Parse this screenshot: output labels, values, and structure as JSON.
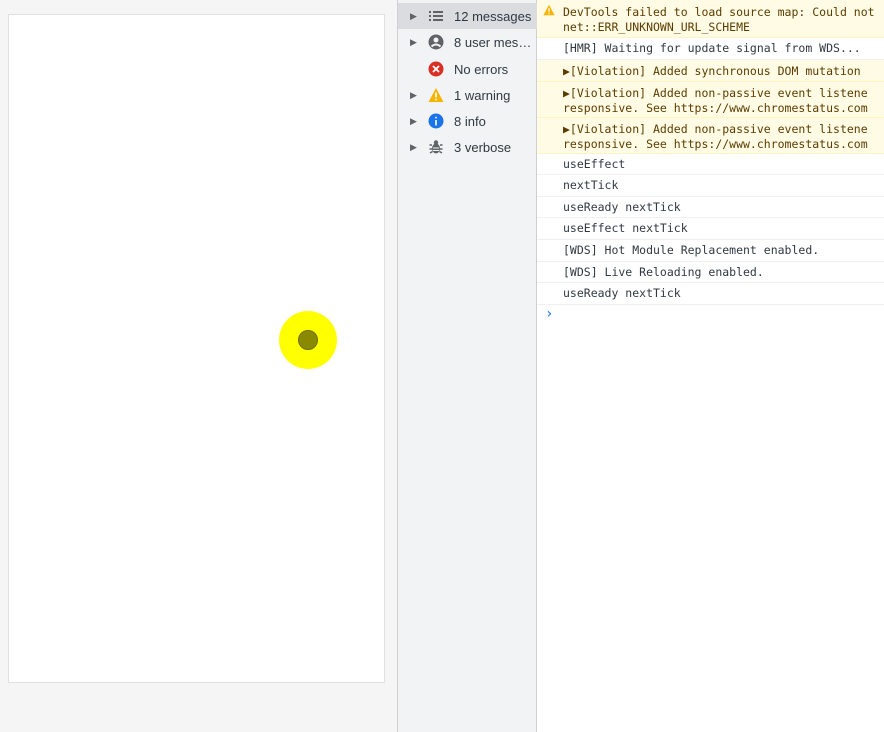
{
  "sidebar": {
    "items": [
      {
        "label": "12 messages",
        "icon": "list-icon",
        "arrow": true,
        "selected": true
      },
      {
        "label": "8 user mess…",
        "icon": "user-icon",
        "arrow": true,
        "selected": false
      },
      {
        "label": "No errors",
        "icon": "error-icon",
        "arrow": false,
        "selected": false
      },
      {
        "label": "1 warning",
        "icon": "warning-icon",
        "arrow": true,
        "selected": false
      },
      {
        "label": "8 info",
        "icon": "info-icon",
        "arrow": true,
        "selected": false
      },
      {
        "label": "3 verbose",
        "icon": "bug-icon",
        "arrow": true,
        "selected": false
      }
    ]
  },
  "console": {
    "messages": [
      {
        "type": "warn",
        "lines": [
          "DevTools failed to load source map: Could not",
          "net::ERR_UNKNOWN_URL_SCHEME"
        ]
      },
      {
        "type": "log",
        "lines": [
          "[HMR] Waiting for update signal from WDS..."
        ]
      },
      {
        "type": "warn",
        "lines": [
          "▶[Violation] Added synchronous DOM mutation"
        ]
      },
      {
        "type": "warn",
        "lines": [
          "▶[Violation] Added non-passive event listene",
          "responsive. See https://www.chromestatus.com"
        ]
      },
      {
        "type": "warn",
        "lines": [
          "▶[Violation] Added non-passive event listene",
          "responsive. See https://www.chromestatus.com"
        ]
      },
      {
        "type": "log",
        "lines": [
          "useEffect"
        ]
      },
      {
        "type": "log",
        "lines": [
          "nextTick"
        ]
      },
      {
        "type": "log",
        "lines": [
          "useReady nextTick"
        ]
      },
      {
        "type": "log",
        "lines": [
          "useEffect nextTick"
        ]
      },
      {
        "type": "log",
        "lines": [
          "[WDS] Hot Module Replacement enabled."
        ]
      },
      {
        "type": "log",
        "lines": [
          "[WDS] Live Reloading enabled."
        ]
      },
      {
        "type": "log",
        "lines": [
          "useReady nextTick"
        ]
      }
    ],
    "prompt": "›"
  },
  "colors": {
    "warning_bg": "#fffbe5",
    "warning_icon": "#f4b400",
    "error_icon": "#d93025",
    "info_icon": "#1a73e8",
    "cursor": "#ffff00"
  }
}
